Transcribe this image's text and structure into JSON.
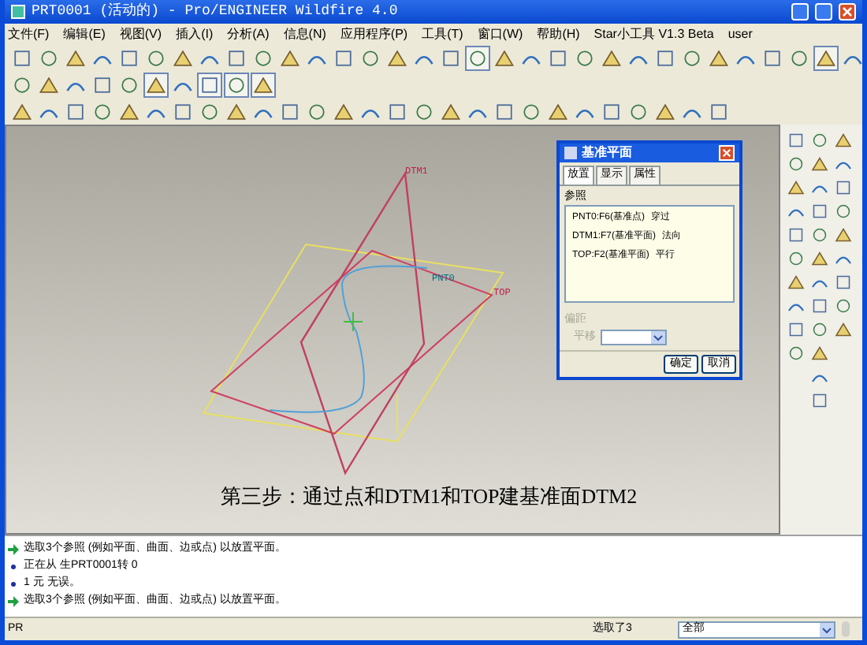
{
  "window": {
    "title": "PRT0001 (活动的) - Pro/ENGINEER Wildfire 4.0"
  },
  "menu": [
    "文件(F)",
    "编辑(E)",
    "视图(V)",
    "插入(I)",
    "分析(A)",
    "信息(N)",
    "应用程序(P)",
    "工具(T)",
    "窗口(W)",
    "帮助(H)",
    "Star小工具 V1.3 Beta",
    "user"
  ],
  "toolbars": [
    {
      "buttons": [
        {
          "pressed": false
        },
        {
          "pressed": false
        },
        {
          "pressed": false
        },
        {
          "pressed": false
        },
        {
          "pressed": false
        },
        {
          "pressed": false
        },
        {
          "pressed": false
        },
        {
          "pressed": false
        },
        {
          "pressed": false
        },
        {
          "pressed": false
        },
        {
          "pressed": false
        },
        {
          "pressed": false
        },
        {
          "pressed": false
        },
        {
          "pressed": false
        },
        {
          "pressed": false
        },
        {
          "pressed": false
        },
        {
          "pressed": false
        },
        {
          "pressed": true
        },
        {
          "pressed": false
        },
        {
          "pressed": false
        },
        {
          "pressed": false
        },
        {
          "pressed": false
        },
        {
          "pressed": false
        },
        {
          "pressed": false
        },
        {
          "pressed": false
        },
        {
          "pressed": false
        },
        {
          "pressed": false
        },
        {
          "pressed": false
        },
        {
          "pressed": false
        },
        {
          "pressed": false
        },
        {
          "pressed": true
        },
        {
          "pressed": false
        }
      ]
    },
    {
      "buttons": [
        {
          "pressed": false
        },
        {
          "pressed": false
        },
        {
          "pressed": false
        },
        {
          "pressed": false
        },
        {
          "pressed": false
        },
        {
          "pressed": true
        },
        {
          "pressed": false
        },
        {
          "pressed": true
        },
        {
          "pressed": true
        },
        {
          "pressed": true
        }
      ]
    },
    {
      "buttons": [
        {
          "pressed": false
        },
        {
          "pressed": false
        },
        {
          "pressed": false
        },
        {
          "pressed": false
        },
        {
          "pressed": false
        },
        {
          "pressed": false
        },
        {
          "pressed": false
        },
        {
          "pressed": false
        },
        {
          "pressed": false
        },
        {
          "pressed": false
        },
        {
          "pressed": false
        },
        {
          "pressed": false
        },
        {
          "pressed": false
        },
        {
          "pressed": false
        },
        {
          "pressed": false
        },
        {
          "pressed": false
        },
        {
          "pressed": false
        },
        {
          "pressed": false
        },
        {
          "pressed": false
        },
        {
          "pressed": false
        },
        {
          "pressed": false
        },
        {
          "pressed": false
        },
        {
          "pressed": false
        },
        {
          "pressed": false
        },
        {
          "pressed": false
        },
        {
          "pressed": false
        },
        {
          "pressed": false
        }
      ]
    }
  ],
  "canvas": {
    "labels": [
      {
        "kind": "datum",
        "text": "DTM1"
      },
      {
        "kind": "datum",
        "text": "TOP"
      },
      {
        "kind": "point",
        "text": "PNT0"
      }
    ],
    "caption": "第三步：通过点和DTM1和TOP建基准面DTM2"
  },
  "dialog": {
    "title": "基准平面",
    "tabs": [
      {
        "label": "放置",
        "selected": true
      },
      {
        "label": "显示",
        "selected": false
      },
      {
        "label": "属性",
        "selected": false
      }
    ],
    "section": "参照",
    "references": [
      {
        "ref": "PNT0:F6(基准点)",
        "constraint": "穿过"
      },
      {
        "ref": "DTM1:F7(基准平面)",
        "constraint": "法向"
      },
      {
        "ref": "TOP:F2(基准平面)",
        "constraint": "平行"
      }
    ],
    "offset": {
      "label": "偏距",
      "field_label": "平移",
      "disabled": true
    },
    "buttons": [
      "确定",
      "取消"
    ]
  },
  "messages": [
    {
      "kind": "prompt",
      "text": "选取3个参照 (例如平面、曲面、边或点) 以放置平面。"
    },
    {
      "kind": "info",
      "text": "正在从 生PRT0001转 0"
    },
    {
      "kind": "info",
      "text": "1 元 无误。"
    },
    {
      "kind": "prompt",
      "text": "选取3个参照 (例如平面、曲面、边或点) 以放置平面。"
    }
  ],
  "status_bar": {
    "left": "PR",
    "selection": "选取了3",
    "filter": "全部"
  }
}
